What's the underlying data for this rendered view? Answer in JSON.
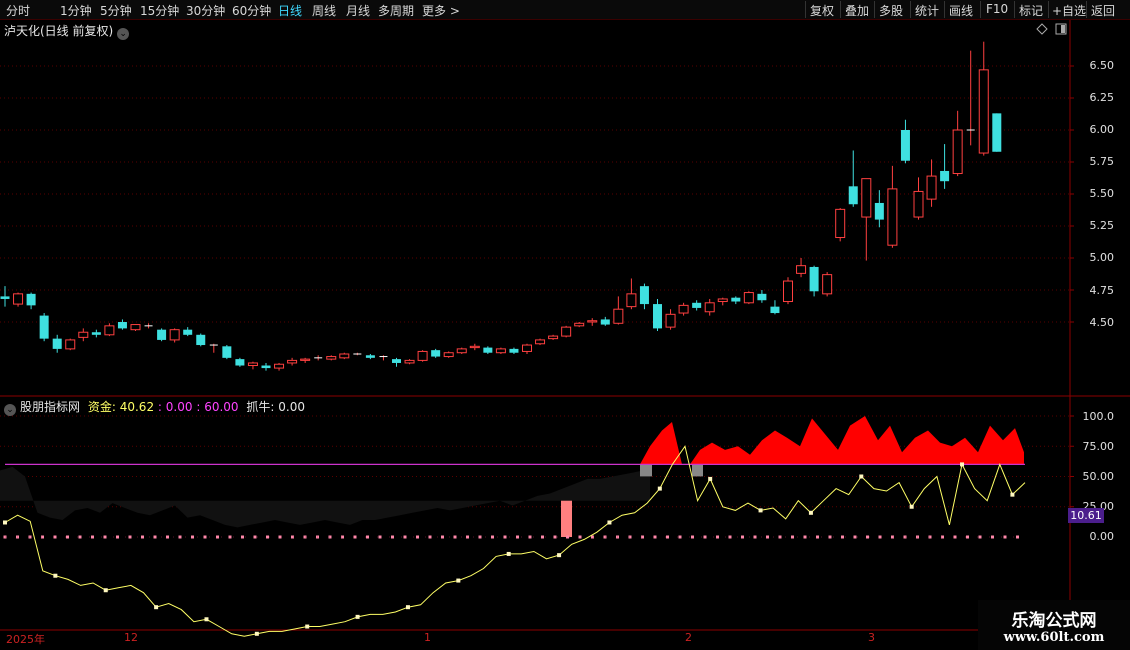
{
  "toolbar": {
    "periods": [
      "分时",
      "1分钟",
      "5分钟",
      "15分钟",
      "30分钟",
      "60分钟",
      "日线",
      "周线",
      "月线",
      "多周期",
      "更多"
    ],
    "active_period": "日线",
    "more_arrow": ">",
    "actions": [
      "复权",
      "叠加",
      "多股",
      "统计",
      "画线",
      "F10",
      "标记",
      "+自选",
      "返回"
    ]
  },
  "chart_title": "泸天化(日线 前复权)",
  "dropdown_glyph": "⌄",
  "price_axis": {
    "ticks": [
      "6.50",
      "6.25",
      "6.00",
      "5.75",
      "5.50",
      "5.25",
      "5.00",
      "4.75",
      "4.50"
    ],
    "range": [
      4.0,
      6.8
    ]
  },
  "indicator": {
    "name": "股朋指标网",
    "label_fund": "资金:",
    "value_fund": "40.62",
    "sep1": ":",
    "value_a": "0.00",
    "sep2": ":",
    "value_b": "60.00",
    "label_catch": "抓牛:",
    "value_catch": "0.00",
    "axis_ticks": [
      "100.0",
      "75.00",
      "50.00",
      "25.00",
      "0.00"
    ],
    "current_value": "10.61"
  },
  "x_axis": {
    "labels": [
      "2025年",
      "12",
      "1",
      "2",
      "3"
    ]
  },
  "watermark": {
    "line1": "乐淘公式网",
    "line2": "www.60lt.com"
  },
  "colors": {
    "up": "#ff4040",
    "down": "#3fe0e0",
    "threshold_line": "#cc33cc",
    "fund_line": "#ffff66",
    "zero_dots": "#ff88aa",
    "red_area": "#ff0000",
    "grey_block": "#888888",
    "pink_bar": "#ff8080"
  },
  "chart_data": {
    "type": "candlestick",
    "candles": [
      [
        4.7,
        4.68,
        4.78,
        4.62
      ],
      [
        4.64,
        4.72,
        4.73,
        4.62
      ],
      [
        4.72,
        4.63,
        4.73,
        4.6
      ],
      [
        4.55,
        4.37,
        4.57,
        4.35
      ],
      [
        4.37,
        4.29,
        4.4,
        4.26
      ],
      [
        4.29,
        4.36,
        4.37,
        4.28
      ],
      [
        4.38,
        4.42,
        4.45,
        4.35
      ],
      [
        4.42,
        4.4,
        4.44,
        4.38
      ],
      [
        4.4,
        4.47,
        4.49,
        4.39
      ],
      [
        4.5,
        4.45,
        4.52,
        4.44
      ],
      [
        4.44,
        4.48,
        4.48,
        4.43
      ],
      [
        4.47,
        4.47,
        4.49,
        4.45
      ],
      [
        4.44,
        4.36,
        4.45,
        4.35
      ],
      [
        4.36,
        4.44,
        4.45,
        4.34
      ],
      [
        4.44,
        4.4,
        4.46,
        4.39
      ],
      [
        4.4,
        4.32,
        4.41,
        4.31
      ],
      [
        4.32,
        4.32,
        4.33,
        4.26
      ],
      [
        4.31,
        4.22,
        4.32,
        4.21
      ],
      [
        4.21,
        4.16,
        4.22,
        4.15
      ],
      [
        4.16,
        4.18,
        4.19,
        4.13
      ],
      [
        4.16,
        4.14,
        4.18,
        4.12
      ],
      [
        4.14,
        4.17,
        4.18,
        4.12
      ],
      [
        4.18,
        4.2,
        4.22,
        4.16
      ],
      [
        4.2,
        4.21,
        4.22,
        4.18
      ],
      [
        4.22,
        4.22,
        4.24,
        4.2
      ],
      [
        4.21,
        4.23,
        4.24,
        4.2
      ],
      [
        4.22,
        4.25,
        4.26,
        4.21
      ],
      [
        4.25,
        4.25,
        4.26,
        4.24
      ],
      [
        4.24,
        4.22,
        4.25,
        4.21
      ],
      [
        4.23,
        4.23,
        4.24,
        4.2
      ],
      [
        4.21,
        4.18,
        4.22,
        4.15
      ],
      [
        4.18,
        4.2,
        4.21,
        4.17
      ],
      [
        4.2,
        4.27,
        4.28,
        4.19
      ],
      [
        4.28,
        4.23,
        4.29,
        4.22
      ],
      [
        4.23,
        4.26,
        4.27,
        4.22
      ],
      [
        4.26,
        4.29,
        4.3,
        4.25
      ],
      [
        4.3,
        4.31,
        4.33,
        4.28
      ],
      [
        4.3,
        4.26,
        4.31,
        4.25
      ],
      [
        4.26,
        4.29,
        4.3,
        4.25
      ],
      [
        4.29,
        4.26,
        4.3,
        4.25
      ],
      [
        4.27,
        4.32,
        4.33,
        4.25
      ],
      [
        4.33,
        4.36,
        4.37,
        4.32
      ],
      [
        4.37,
        4.39,
        4.4,
        4.36
      ],
      [
        4.39,
        4.46,
        4.47,
        4.38
      ],
      [
        4.47,
        4.49,
        4.5,
        4.46
      ],
      [
        4.5,
        4.51,
        4.53,
        4.47
      ],
      [
        4.52,
        4.48,
        4.54,
        4.47
      ],
      [
        4.49,
        4.6,
        4.7,
        4.48
      ],
      [
        4.62,
        4.72,
        4.84,
        4.6
      ],
      [
        4.78,
        4.64,
        4.8,
        4.6
      ],
      [
        4.64,
        4.45,
        4.68,
        4.43
      ],
      [
        4.46,
        4.56,
        4.6,
        4.44
      ],
      [
        4.57,
        4.63,
        4.65,
        4.55
      ],
      [
        4.65,
        4.61,
        4.67,
        4.59
      ],
      [
        4.58,
        4.65,
        4.68,
        4.55
      ],
      [
        4.66,
        4.68,
        4.69,
        4.63
      ],
      [
        4.69,
        4.66,
        4.7,
        4.64
      ],
      [
        4.65,
        4.73,
        4.74,
        4.64
      ],
      [
        4.72,
        4.67,
        4.75,
        4.65
      ],
      [
        4.62,
        4.57,
        4.67,
        4.56
      ],
      [
        4.66,
        4.82,
        4.85,
        4.64
      ],
      [
        4.88,
        4.94,
        5.0,
        4.85
      ],
      [
        4.93,
        4.74,
        4.94,
        4.7
      ],
      [
        4.72,
        4.87,
        4.89,
        4.7
      ],
      [
        5.16,
        5.38,
        5.39,
        5.13
      ],
      [
        5.56,
        5.42,
        5.84,
        5.4
      ],
      [
        5.32,
        5.62,
        5.62,
        4.98
      ],
      [
        5.43,
        5.3,
        5.53,
        5.24
      ],
      [
        5.1,
        5.54,
        5.72,
        5.08
      ],
      [
        6.0,
        5.76,
        6.08,
        5.74
      ],
      [
        5.32,
        5.52,
        5.63,
        5.3
      ],
      [
        5.46,
        5.64,
        5.77,
        5.4
      ],
      [
        5.68,
        5.6,
        5.89,
        5.54
      ],
      [
        5.66,
        6.0,
        6.15,
        5.64
      ],
      [
        6.0,
        6.0,
        6.62,
        5.88
      ],
      [
        5.82,
        6.47,
        6.69,
        5.8
      ],
      [
        6.13,
        5.83,
        6.13,
        5.83
      ]
    ],
    "fund_line": [
      12,
      18,
      13,
      -28,
      -32,
      -35,
      -40,
      -38,
      -44,
      -42,
      -40,
      -46,
      -58,
      -55,
      -60,
      -70,
      -68,
      -74,
      -80,
      -82,
      -80,
      -78,
      -78,
      -76,
      -74,
      -74,
      -72,
      -70,
      -66,
      -64,
      -64,
      -62,
      -58,
      -56,
      -46,
      -38,
      -36,
      -32,
      -26,
      -16,
      -14,
      -14,
      -12,
      -18,
      -15,
      -6,
      -2,
      4,
      12,
      18,
      20,
      28,
      40,
      60,
      75,
      30,
      48,
      25,
      22,
      28,
      22,
      24,
      15,
      30,
      20,
      30,
      40,
      35,
      50,
      40,
      38,
      45,
      25,
      40,
      50,
      10,
      60,
      40,
      30,
      60,
      35,
      45
    ],
    "threshold": 60,
    "zero_line": 0
  }
}
